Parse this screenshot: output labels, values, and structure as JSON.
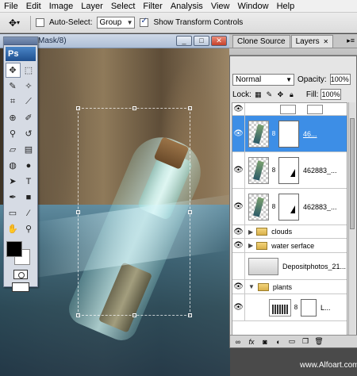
{
  "menu": [
    "File",
    "Edit",
    "Image",
    "Layer",
    "Select",
    "Filter",
    "Analysis",
    "View",
    "Window",
    "Help"
  ],
  "options": {
    "move_icon": "move-tool-icon",
    "auto_select_label": "Auto-Select:",
    "auto_select_checked": false,
    "group_value": "Group",
    "show_transform_label": "Show Transform Controls",
    "show_transform_checked": true
  },
  "document": {
    "title": "Mask/8)",
    "btn_min": "_",
    "btn_max": "□",
    "btn_close": "✕"
  },
  "tools_panel": {
    "logo": "Ps",
    "tools": [
      {
        "name": "move-tool-icon",
        "glyph": "✥",
        "selected": true
      },
      {
        "name": "marquee-tool-icon",
        "glyph": "⬚",
        "selected": false
      },
      {
        "name": "lasso-tool-icon",
        "glyph": "✎",
        "selected": false
      },
      {
        "name": "magic-wand-tool-icon",
        "glyph": "✧",
        "selected": false
      },
      {
        "name": "crop-tool-icon",
        "glyph": "⌗",
        "selected": false
      },
      {
        "name": "slice-tool-icon",
        "glyph": "⟋",
        "selected": false
      },
      {
        "name": "healing-brush-tool-icon",
        "glyph": "⊕",
        "selected": false
      },
      {
        "name": "brush-tool-icon",
        "glyph": "✐",
        "selected": false
      },
      {
        "name": "clone-stamp-tool-icon",
        "glyph": "⚲",
        "selected": false
      },
      {
        "name": "history-brush-tool-icon",
        "glyph": "↺",
        "selected": false
      },
      {
        "name": "eraser-tool-icon",
        "glyph": "▱",
        "selected": false
      },
      {
        "name": "gradient-tool-icon",
        "glyph": "▤",
        "selected": false
      },
      {
        "name": "blur-tool-icon",
        "glyph": "◍",
        "selected": false
      },
      {
        "name": "dodge-tool-icon",
        "glyph": "●",
        "selected": false
      },
      {
        "name": "path-selection-tool-icon",
        "glyph": "➤",
        "selected": false
      },
      {
        "name": "type-tool-icon",
        "glyph": "T",
        "selected": false
      },
      {
        "name": "pen-tool-icon",
        "glyph": "✒",
        "selected": false
      },
      {
        "name": "shape-tool-icon",
        "glyph": "■",
        "selected": false
      },
      {
        "name": "notes-tool-icon",
        "glyph": "▭",
        "selected": false
      },
      {
        "name": "eyedropper-tool-icon",
        "glyph": "⁄",
        "selected": false
      },
      {
        "name": "hand-tool-icon",
        "glyph": "✋",
        "selected": false
      },
      {
        "name": "zoom-tool-icon",
        "glyph": "⚲",
        "selected": false
      }
    ]
  },
  "layers_panel": {
    "tabs": [
      "Clone Source",
      "Layers"
    ],
    "tab_close": "✕",
    "blend_mode": "Normal",
    "opacity_label": "Opacity:",
    "opacity_value": "100%",
    "lock_label": "Lock:",
    "fill_label": "Fill:",
    "fill_value": "100%",
    "layers": [
      {
        "kind": "partial",
        "visible": true,
        "name": ""
      },
      {
        "kind": "layer",
        "visible": true,
        "name": "46...",
        "selected": true
      },
      {
        "kind": "layer",
        "visible": true,
        "name": "462883_...",
        "selected": false
      },
      {
        "kind": "layer",
        "visible": true,
        "name": "462883_...",
        "selected": false
      },
      {
        "kind": "group",
        "visible": true,
        "name": "clouds"
      },
      {
        "kind": "group",
        "visible": true,
        "name": "water serface"
      },
      {
        "kind": "image",
        "visible": false,
        "name": "Depositphotos_21..."
      },
      {
        "kind": "group",
        "visible": true,
        "name": "plants",
        "open": true
      },
      {
        "kind": "adjust",
        "visible": true,
        "name": "L..."
      }
    ],
    "footer_icons": [
      "link-icon",
      "fx-icon",
      "add-mask-icon",
      "adjustment-icon",
      "folder-icon",
      "new-layer-icon",
      "trash-icon"
    ]
  },
  "watermark": "www.Alfoart.com"
}
